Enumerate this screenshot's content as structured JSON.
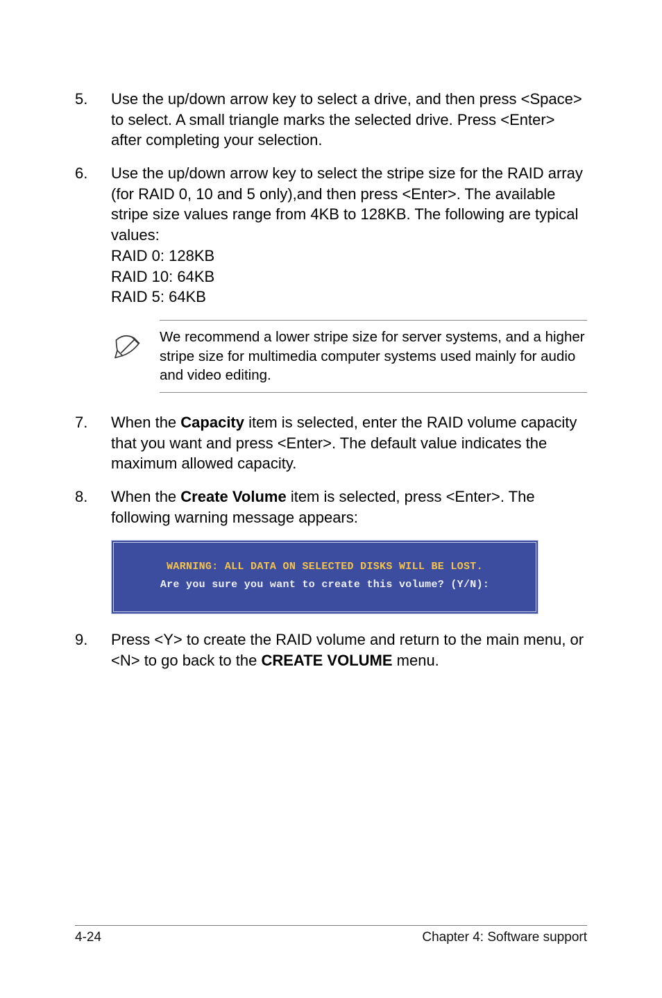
{
  "steps": {
    "s5": {
      "num": "5.",
      "text": "Use the up/down arrow key to select a drive, and then press <Space> to select. A small triangle marks the selected drive. Press <Enter> after completing your selection."
    },
    "s6": {
      "num": "6.",
      "text": "Use the up/down arrow key to select the stripe size for the RAID array (for RAID 0, 10 and 5 only),and  then press <Enter>. The available stripe size values range from 4KB to 128KB. The following are typical values:",
      "l1": "RAID 0: 128KB",
      "l2": "RAID 10: 64KB",
      "l3": "RAID 5: 64KB"
    },
    "s7": {
      "num": "7.",
      "pre": "When the ",
      "bold": "Capacity",
      "post": " item is selected, enter the RAID volume capacity that you want and press <Enter>. The default value indicates the maximum allowed capacity."
    },
    "s8": {
      "num": "8.",
      "pre": "When the ",
      "bold": "Create Volume",
      "post": " item is selected, press <Enter>. The following warning message appears:"
    },
    "s9": {
      "num": "9.",
      "pre": "Press <Y> to create the RAID volume and return to the main menu, or <N> to go back to the ",
      "bold": "CREATE VOLUME",
      "post": " menu."
    }
  },
  "note": {
    "text": "We recommend a lower stripe size for server systems, and a higher stripe size for multimedia computer systems used mainly for audio and video editing."
  },
  "console": {
    "warn": "WARNING: ALL DATA ON SELECTED DISKS WILL BE LOST.",
    "prompt": "Are you sure you want to create this volume? (Y/N):"
  },
  "footer": {
    "left": "4-24",
    "right": "Chapter 4: Software support"
  }
}
